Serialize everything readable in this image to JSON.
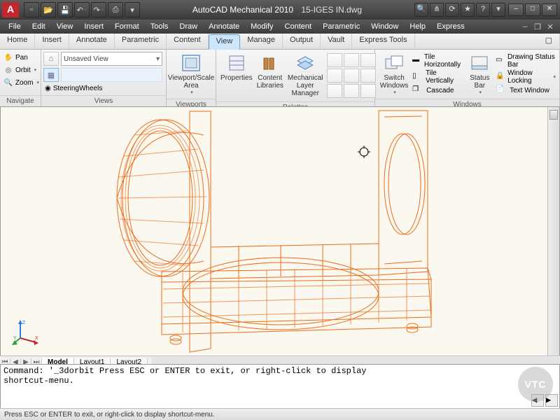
{
  "app": {
    "name": "AutoCAD Mechanical 2010",
    "document": "15-IGES IN.dwg",
    "logo_letter": "A"
  },
  "qat": {
    "new": "▫",
    "open": "📂",
    "save": "💾",
    "undo": "↶",
    "redo": "↷",
    "plot": "⎙"
  },
  "menubar": [
    "File",
    "Edit",
    "View",
    "Insert",
    "Format",
    "Tools",
    "Draw",
    "Annotate",
    "Modify",
    "Content",
    "Parametric",
    "Window",
    "Help",
    "Express"
  ],
  "tabs": {
    "items": [
      "Home",
      "Insert",
      "Annotate",
      "Parametric",
      "Content",
      "View",
      "Manage",
      "Output",
      "Vault",
      "Express Tools"
    ],
    "active": "View"
  },
  "navigate": {
    "pan": "Pan",
    "orbit": "Orbit",
    "zoom": "Zoom",
    "panel": "Navigate"
  },
  "views": {
    "combo": "Unsaved View",
    "wheels": "SteeringWheels",
    "panel": "Views"
  },
  "viewports": {
    "btn": "Viewport/Scale Area",
    "panel": "Viewports"
  },
  "palettes": {
    "properties": "Properties",
    "content": "Content Libraries",
    "layer": "Mechanical Layer Manager",
    "panel": "Palettes"
  },
  "windows": {
    "switch": "Switch Windows",
    "tile_h": "Tile Horizontally",
    "tile_v": "Tile Vertically",
    "cascade": "Cascade",
    "status": "Status Bar",
    "drawing_status": "Drawing Status Bar",
    "window_lock": "Window Locking",
    "text_win": "Text Window",
    "panel": "Windows"
  },
  "layout_tabs": {
    "model": "Model",
    "layout1": "Layout1",
    "layout2": "Layout2"
  },
  "command": {
    "line1": "Command: '_3dorbit Press ESC or ENTER to exit, or right-click to display",
    "line2": "shortcut-menu."
  },
  "status": {
    "hint": "Press ESC or ENTER to exit, or right-click to display shortcut-menu."
  },
  "watermark": "VTC",
  "ucs": {
    "x": "X",
    "y": "Y",
    "z": "Z"
  }
}
